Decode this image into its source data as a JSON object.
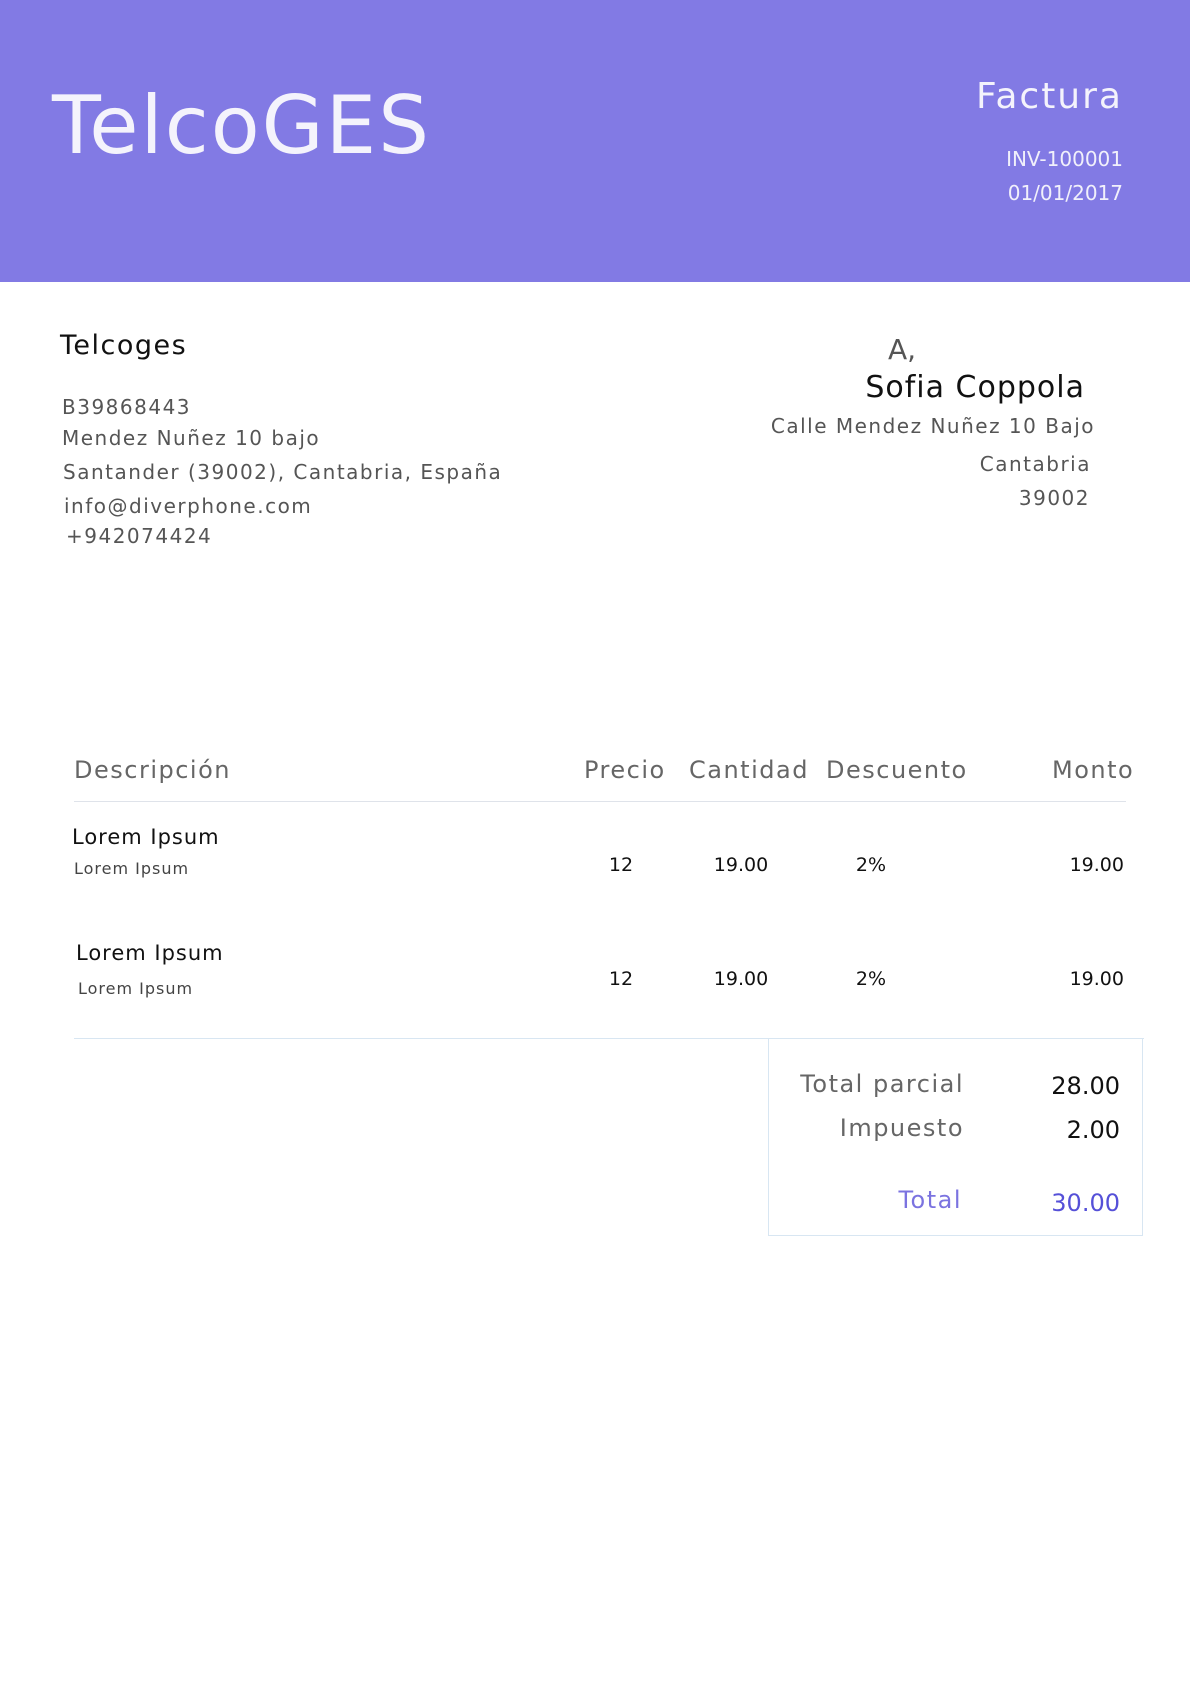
{
  "header": {
    "brand": "TelcoGES",
    "doc_type": "Factura",
    "invoice_number": "INV-100001",
    "date": "01/01/2017",
    "accent_color": "#827ae4"
  },
  "sender": {
    "name": "Telcoges",
    "tax_id": "B39868443",
    "address_line": "Mendez Nuñez 10 bajo",
    "city_line": "Santander (39002), Cantabria, España",
    "email": "info@diverphone.com",
    "phone": "+942074424"
  },
  "recipient": {
    "prefix": "A,",
    "name": "Sofia Coppola",
    "address": "Calle Mendez Nuñez 10 Bajo",
    "region": "Cantabria",
    "postal_code": "39002"
  },
  "table": {
    "columns": [
      "Descripción",
      "Precio",
      "Cantidad",
      "Descuento",
      "Monto"
    ],
    "rows": [
      {
        "title": "Lorem Ipsum",
        "subtitle": "Lorem Ipsum",
        "price": "12",
        "quantity": "19.00",
        "discount": "2%",
        "amount": "19.00"
      },
      {
        "title": "Lorem Ipsum",
        "subtitle": "Lorem Ipsum",
        "price": "12",
        "quantity": "19.00",
        "discount": "2%",
        "amount": "19.00"
      }
    ]
  },
  "totals": {
    "subtotal_label": "Total parcial",
    "subtotal_value": "28.00",
    "tax_label": "Impuesto",
    "tax_value": "2.00",
    "total_label": "Total",
    "total_value": "30.00",
    "total_color": "#5550d8"
  }
}
